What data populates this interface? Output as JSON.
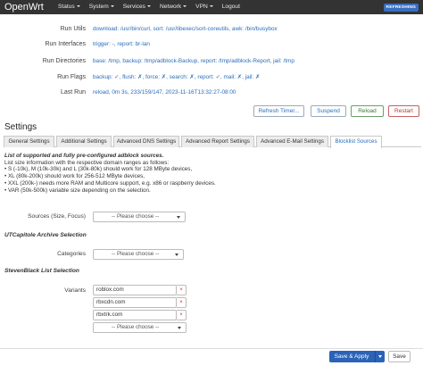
{
  "navbar": {
    "brand": "OpenWrt",
    "menu": [
      "Status",
      "System",
      "Services",
      "Network",
      "VPN",
      "Logout"
    ],
    "badge": "REFRESHING"
  },
  "status": [
    {
      "label": "Run Utils",
      "value": "download: /usr/bin/curl, sort: /usr/libexec/sort-coreutils, awk: /bin/busybox"
    },
    {
      "label": "Run Interfaces",
      "value": "trigger: -, report: br-lan"
    },
    {
      "label": "Run Directories",
      "value": "base: /tmp, backup: /tmp/adblock-Backup, report: /tmp/adblock-Report, jail: /tmp"
    },
    {
      "label": "Run Flags",
      "value": "backup: ✓, flush: ✗, force: ✗, search: ✗, report: ✓, mail: ✗, jail: ✗"
    },
    {
      "label": "Last Run",
      "value": "reload, 0m 3s, 233/159/147, 2023-11-16T13:32:27-08:00"
    }
  ],
  "actions": {
    "refresh": "Refresh Timer...",
    "suspend": "Suspend",
    "reload": "Reload",
    "restart": "Restart"
  },
  "settings_title": "Settings",
  "tabs": [
    "General Settings",
    "Additional Settings",
    "Advanced DNS Settings",
    "Advanced Report Settings",
    "Advanced E-Mail Settings",
    "Blocklist Sources"
  ],
  "intro": {
    "title": "List of supported and fully pre-configured adblock sources.",
    "line1": "List size information with the respective domain ranges as follows:",
    "line2": "• S (-10k), M (10k-30k) and L (30k-80k) should work for 128 MByte devices,",
    "line3": "• XL (80k-200k) should work for 256-512 MByte devices,",
    "line4": "• XXL (200k-) needs more RAM and Multicore support, e.g. x86 or raspberry devices.",
    "line5": "• VAR (50k-500k) variable size depending on the selection."
  },
  "form": {
    "sources_label": "Sources (Size, Focus)",
    "placeholder": "-- Please choose --",
    "utc_heading": "UTCapitole Archive Selection",
    "categories_label": "Categories",
    "stevenblack_heading": "StevenBlack List Selection",
    "variants_label": "Variants",
    "variants": [
      "roblox.com",
      "rbxcdn.com",
      "rbxtrk.com"
    ],
    "remove_symbol": "×"
  },
  "footer": {
    "save_apply": "Save & Apply",
    "save": "Save"
  }
}
